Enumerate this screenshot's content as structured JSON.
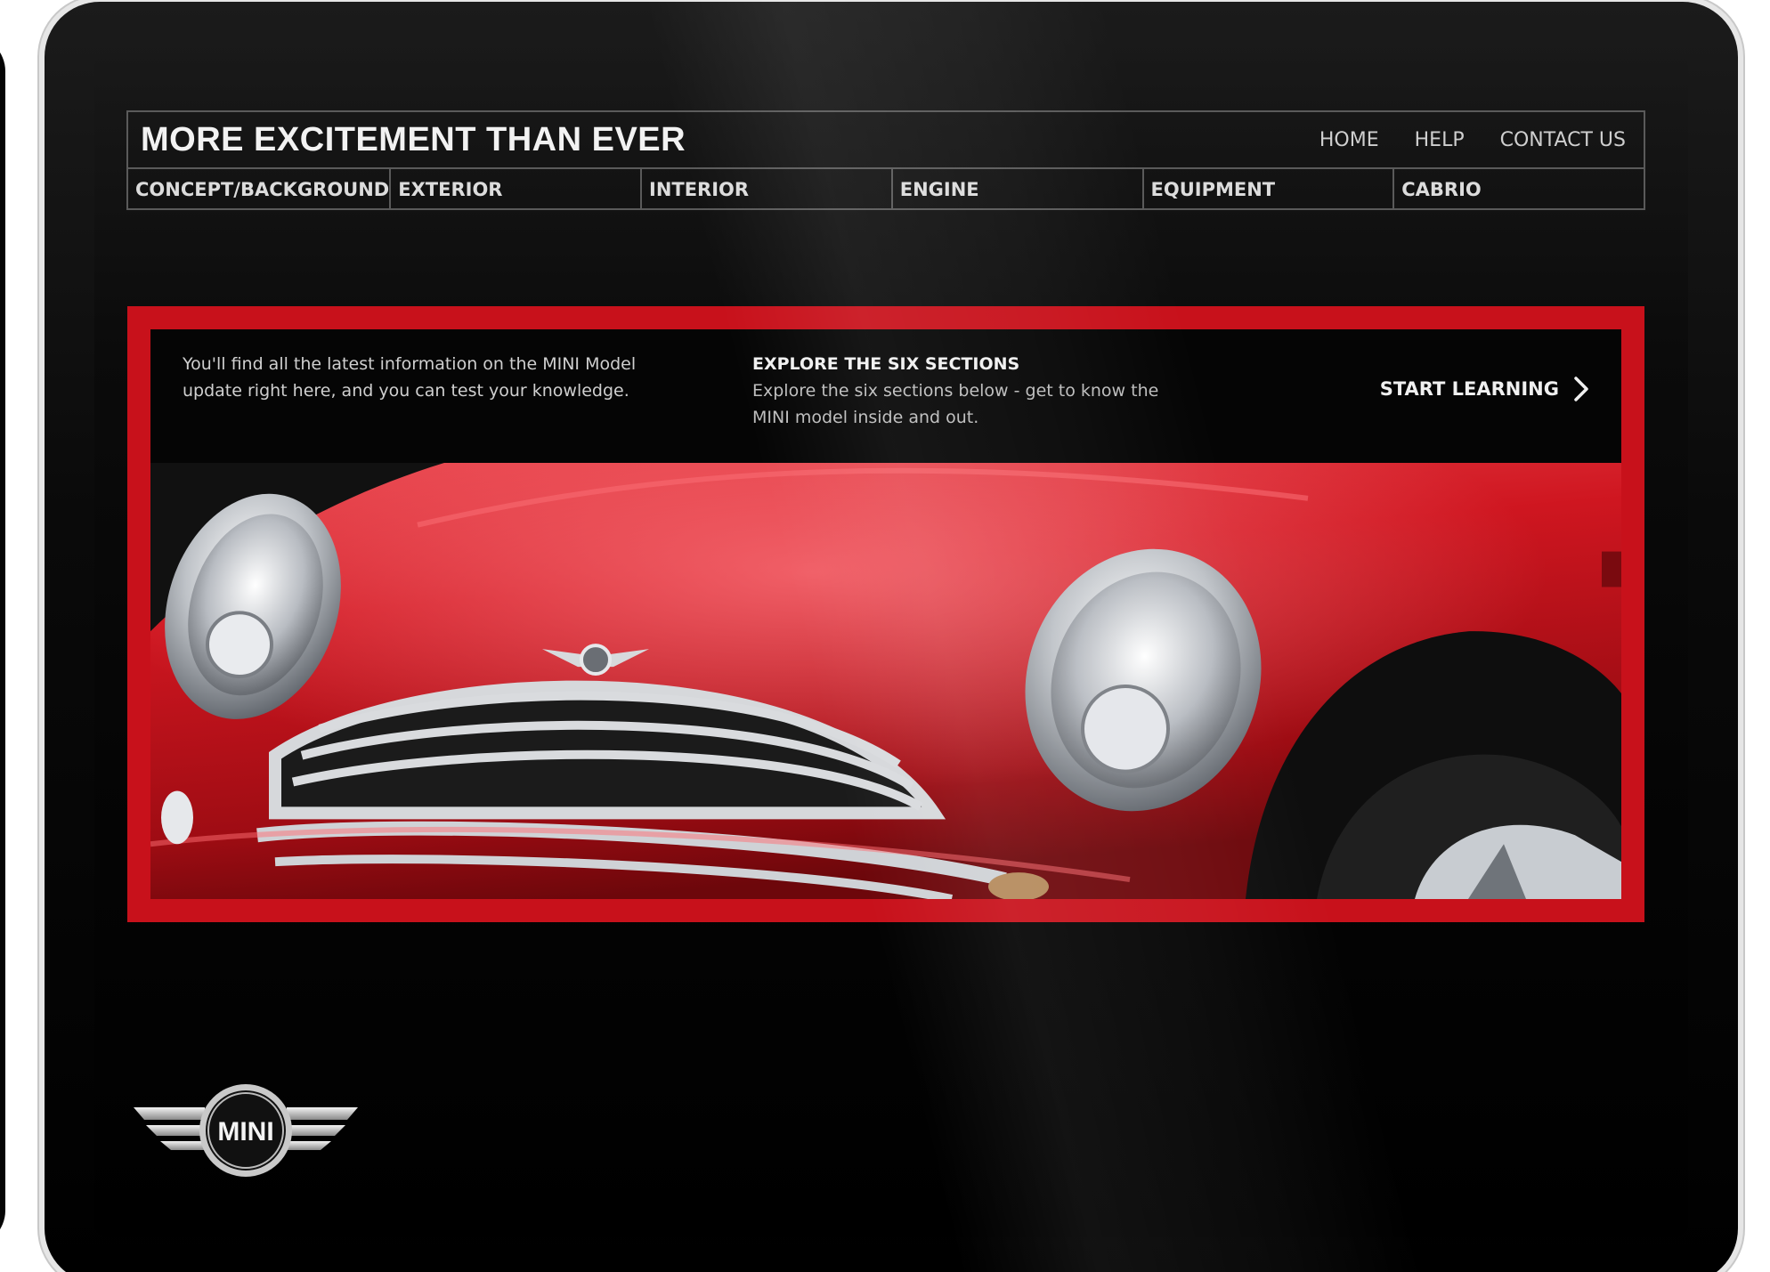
{
  "header": {
    "title": "MORE EXCITEMENT THAN EVER",
    "links": [
      "HOME",
      "HELP",
      "CONTACT US"
    ]
  },
  "sections": [
    "CONCEPT/BACKGROUND",
    "EXTERIOR",
    "INTERIOR",
    "ENGINE",
    "EQUIPMENT",
    "CABRIO"
  ],
  "feature": {
    "intro": "You'll find all the latest information on the MINI Model update right here, and you can test your knowledge.",
    "explore_heading": "EXPLORE THE SIX SECTIONS",
    "explore_text": "Explore the six sections below - get to know the MINI model inside and out.",
    "cta_label": "START LEARNING",
    "cta_icon": "chevron-right-icon",
    "image": "red-mini-car-front-closeup"
  },
  "brand": {
    "logo_text": "MINI",
    "accent_color": "#c8111b"
  }
}
